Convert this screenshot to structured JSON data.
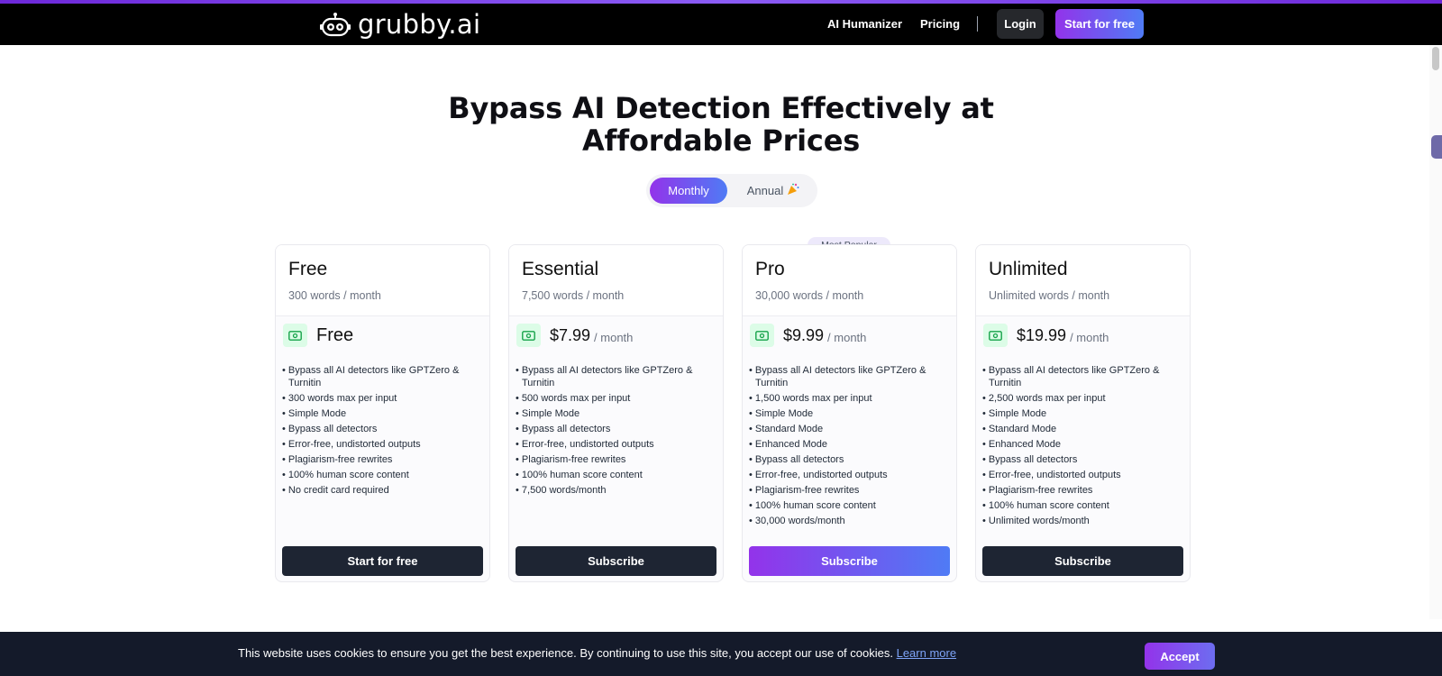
{
  "brand": {
    "name": "grubby.ai",
    "logo_icon": "robot-face-icon"
  },
  "nav": {
    "links": [
      "AI Humanizer",
      "Pricing"
    ],
    "login_label": "Login",
    "start_label": "Start for free"
  },
  "hero": {
    "title_line1": "Bypass AI Detection Effectively at",
    "title_line2": "Affordable Prices"
  },
  "billing_toggle": {
    "monthly_label": "Monthly",
    "annual_label": "Annual",
    "annual_icon": "party-popper-icon",
    "selected": "Monthly"
  },
  "badge_label": "Most Popular",
  "plans": [
    {
      "name": "Free",
      "words": "300 words / month",
      "price": "Free",
      "period": "",
      "features": [
        "• Bypass all AI detectors like GPTZero & Turnitin",
        "• 300 words max per input",
        "• Simple Mode",
        "• Bypass all detectors",
        "• Error-free, undistorted outputs",
        "• Plagiarism-free rewrites",
        "• 100% human score content",
        "• No credit card required"
      ],
      "button": "Start for free"
    },
    {
      "name": "Essential",
      "words": "7,500 words / month",
      "price": "$7.99",
      "period": "/ month",
      "features": [
        "• Bypass all AI detectors like GPTZero & Turnitin",
        "• 500 words max per input",
        "• Simple Mode",
        "• Bypass all detectors",
        "• Error-free, undistorted outputs",
        "• Plagiarism-free rewrites",
        "• 100% human score content",
        "• 7,500 words/month"
      ],
      "button": "Subscribe"
    },
    {
      "name": "Pro",
      "words": "30,000 words / month",
      "price": "$9.99",
      "period": "/ month",
      "features": [
        "• Bypass all AI detectors like GPTZero & Turnitin",
        "• 1,500 words max per input",
        "• Simple Mode",
        "• Standard Mode",
        "• Enhanced Mode",
        "• Bypass all detectors",
        "• Error-free, undistorted outputs",
        "• Plagiarism-free rewrites",
        "• 100% human score content",
        "• 30,000 words/month"
      ],
      "button": "Subscribe"
    },
    {
      "name": "Unlimited",
      "words": "Unlimited words / month",
      "price": "$19.99",
      "period": "/ month",
      "features": [
        "• Bypass all AI detectors like GPTZero & Turnitin",
        "• 2,500 words max per input",
        "• Simple Mode",
        "• Standard Mode",
        "• Enhanced Mode",
        "• Bypass all detectors",
        "• Error-free, undistorted outputs",
        "• Plagiarism-free rewrites",
        "• 100% human score content",
        "• Unlimited words/month"
      ],
      "button": "Subscribe"
    }
  ],
  "cookie": {
    "text": "This website uses cookies to ensure you get the best experience. By continuing to use this site, you accept our use of cookies.",
    "link": "Learn more",
    "accept": "Accept"
  },
  "colors": {
    "accent_gradient_start": "#9333ea",
    "accent_gradient_end": "#4f7bf5",
    "nav_bg": "#000000",
    "button_dark": "#1e2533",
    "cookie_bg": "#141a2a",
    "money_icon_bg": "#dcfce7"
  }
}
